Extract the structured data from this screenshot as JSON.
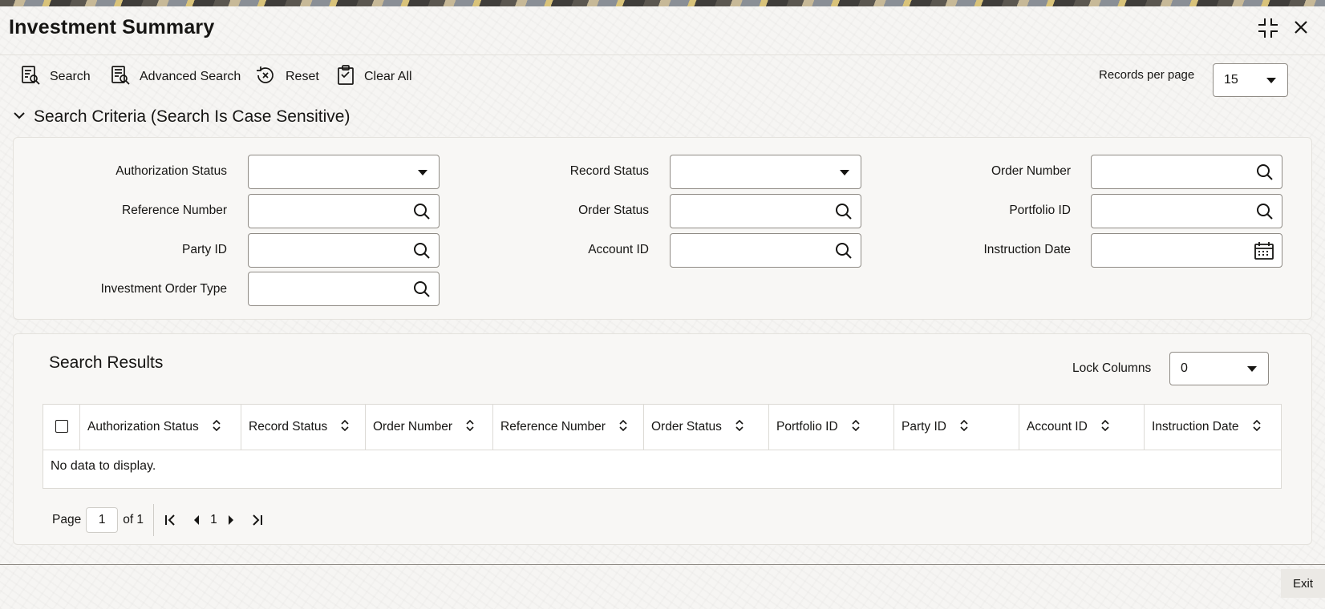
{
  "window": {
    "title": "Investment Summary"
  },
  "toolbar": {
    "search_label": "Search",
    "advanced_search_label": "Advanced Search",
    "reset_label": "Reset",
    "clear_all_label": "Clear All",
    "records_per_page_label": "Records per page",
    "records_per_page_value": "15"
  },
  "criteria": {
    "title": "Search Criteria (Search Is Case Sensitive)",
    "fields": {
      "authorization_status": "Authorization Status",
      "reference_number": "Reference Number",
      "party_id": "Party ID",
      "investment_order_type": "Investment Order Type",
      "record_status": "Record Status",
      "order_status": "Order Status",
      "account_id": "Account ID",
      "order_number": "Order Number",
      "portfolio_id": "Portfolio ID",
      "instruction_date": "Instruction Date"
    }
  },
  "results": {
    "title": "Search Results",
    "lock_columns_label": "Lock Columns",
    "lock_columns_value": "0",
    "columns": [
      "Authorization Status",
      "Record Status",
      "Order Number",
      "Reference Number",
      "Order Status",
      "Portfolio ID",
      "Party ID",
      "Account ID",
      "Instruction Date"
    ],
    "empty_message": "No data to display."
  },
  "pagination": {
    "page_label": "Page",
    "current_page": "1",
    "of_label": "of 1",
    "current_page_link": "1"
  },
  "footer": {
    "exit_label": "Exit"
  }
}
